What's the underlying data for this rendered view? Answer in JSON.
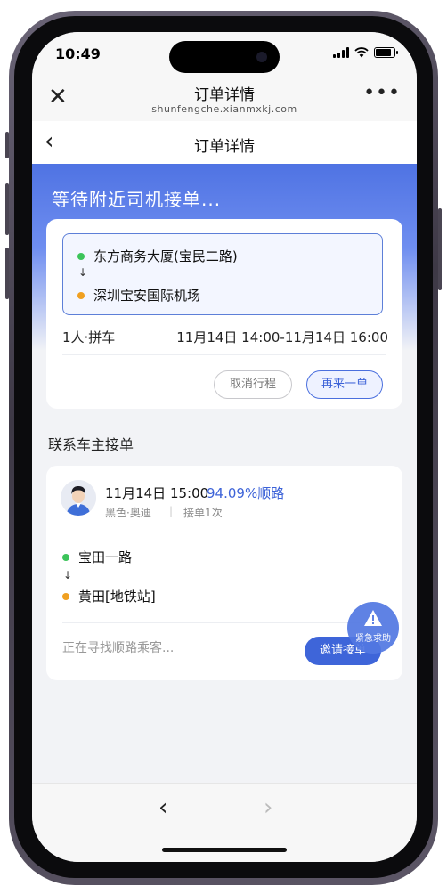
{
  "status_bar": {
    "time": "10:49"
  },
  "browser": {
    "title": "订单详情",
    "url": "shunfengche.xianmxkj.com",
    "close_icon": "close-icon",
    "more_label": "•••"
  },
  "header": {
    "title": "订单详情",
    "back_icon": "chevron-left-icon"
  },
  "hero": {
    "title": "等待附近司机接单..."
  },
  "order": {
    "start": "东方商务大厦(宝民二路)",
    "arrow": "↓",
    "end": "深圳宝安国际机场",
    "passengers": "1人·拼车",
    "time_range": "11月14日 14:00-11月14日 16:00",
    "cancel_label": "取消行程",
    "again_label": "再来一单",
    "start_color": "#3cc45a",
    "end_color": "#f0a021"
  },
  "section": {
    "title": "联系车主接单"
  },
  "driver": {
    "time": "11月14日 15:00",
    "ratio": "94.09%顺路",
    "car": "黑色·奥迪",
    "separator": "|",
    "orders": "接单1次",
    "start": "宝田一路",
    "arrow": "↓",
    "end": "黄田[地铁站]",
    "seeking": "正在寻找顺路乘客...",
    "invite_label": "邀请接单"
  },
  "sos": {
    "label": "紧急求助"
  },
  "nav": {
    "back_label": "‹",
    "forward_label": "›"
  },
  "colors": {
    "accent": "#3e65d9",
    "hero": "#4f73e3"
  }
}
